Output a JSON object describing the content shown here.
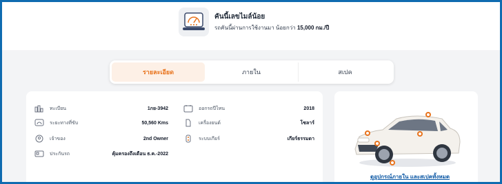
{
  "banner": {
    "title": "คันนี้เลขไมล์น้อย",
    "subtitle_prefix": "รถคันนี้ผ่านการใช้งานมา น้อยกว่า",
    "subtitle_value": "15,000 กม./ปี",
    "icon": "odometer-icon"
  },
  "tabs": [
    {
      "label": "รายละเอียด",
      "active": true
    },
    {
      "label": "ภายใน",
      "active": false
    },
    {
      "label": "สเปค",
      "active": false
    }
  ],
  "details_left": [
    {
      "icon": "registration-icon",
      "label": "ทะเบียน",
      "value": "1กย-3942"
    },
    {
      "icon": "odometer-icon",
      "label": "ระยะทางที่ขับ",
      "value": "50,560 Kms"
    },
    {
      "icon": "owner-icon",
      "label": "เจ้าของ",
      "value": "2nd Owner"
    },
    {
      "icon": "insurance-icon",
      "label": "ประกันรถ",
      "value": "คุ้มครองถึงเดือน ธ.ค.-2022"
    }
  ],
  "details_right": [
    {
      "icon": "calendar-icon",
      "label": "ออกรถปีไหน",
      "value": "2018"
    },
    {
      "icon": "fuel-icon",
      "label": "เครื่องยนต์",
      "value": "โซลาร์"
    },
    {
      "icon": "gear-shift-icon",
      "label": "ระบบเกียร์",
      "value": "เกียร์ธรรมดา"
    }
  ],
  "car_card": {
    "link_label": "ดูอุปกรณ์ภายใน และสเปคทั้งหมด"
  },
  "colors": {
    "accent": "#e8731c",
    "link": "#0b57a4",
    "frame": "#0f6bb0"
  }
}
